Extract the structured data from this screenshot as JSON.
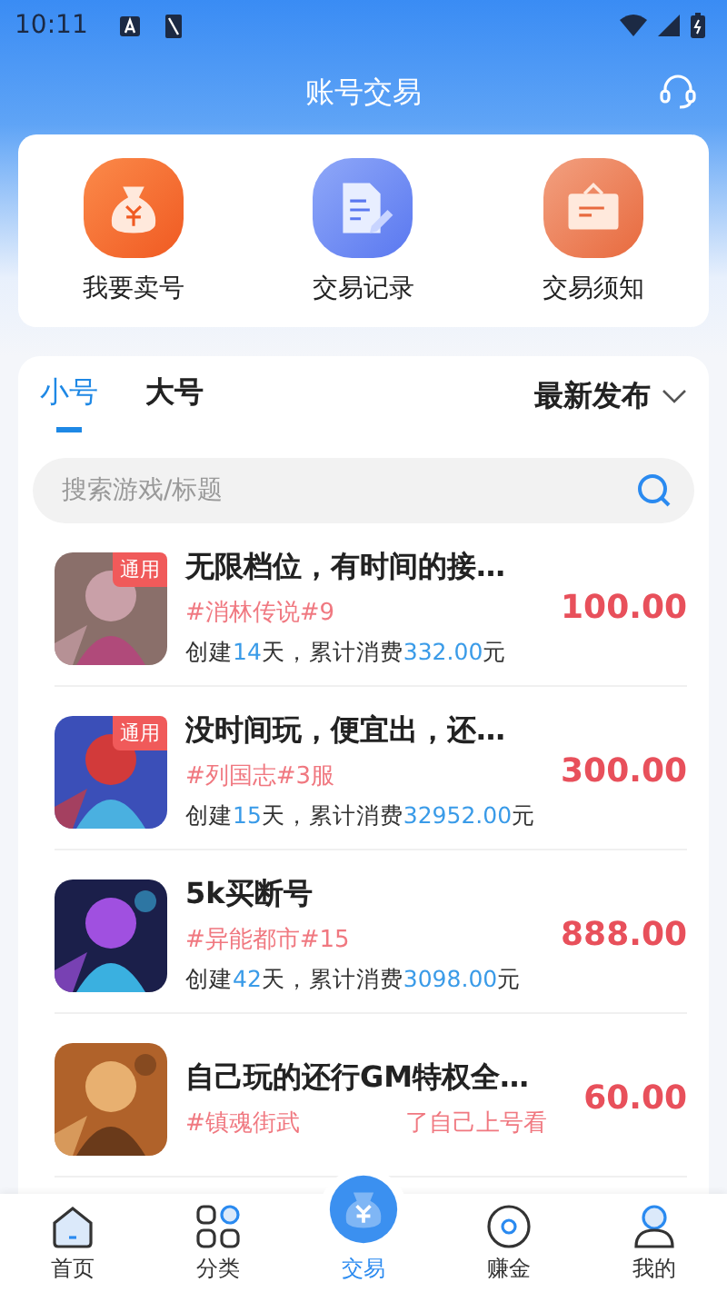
{
  "status_bar": {
    "time": "10:11"
  },
  "header": {
    "title": "账号交易"
  },
  "quick_actions": [
    {
      "label": "我要卖号",
      "kind": "sell"
    },
    {
      "label": "交易记录",
      "kind": "record"
    },
    {
      "label": "交易须知",
      "kind": "notice"
    }
  ],
  "tabs": [
    {
      "label": "小号",
      "selected": true
    },
    {
      "label": "大号",
      "selected": false
    }
  ],
  "sort": {
    "label": "最新发布"
  },
  "search": {
    "placeholder": "搜索游戏/标题"
  },
  "listings": [
    {
      "badge": "通用",
      "title": "无限档位，有时间的接…",
      "tag": "#消林传说#9",
      "meta": [
        {
          "text": "创建",
          "highlight": false
        },
        {
          "text": "14",
          "highlight": true
        },
        {
          "text": "天，累计消费",
          "highlight": false
        },
        {
          "text": "332.00",
          "highlight": true
        },
        {
          "text": "元",
          "highlight": false
        }
      ],
      "price": "100.00"
    },
    {
      "badge": "通用",
      "title": "没时间玩，便宜出，还…",
      "tag": "#列国志#3服",
      "meta": [
        {
          "text": "创建",
          "highlight": false
        },
        {
          "text": "15",
          "highlight": true
        },
        {
          "text": "天，累计消费",
          "highlight": false
        },
        {
          "text": "32952.00",
          "highlight": true
        },
        {
          "text": "元",
          "highlight": false
        }
      ],
      "price": "300.00"
    },
    {
      "title": "5k买断号",
      "tag": "#异能都市#15",
      "meta": [
        {
          "text": "创建",
          "highlight": false
        },
        {
          "text": "42",
          "highlight": true
        },
        {
          "text": "天，累计消费",
          "highlight": false
        },
        {
          "text": "3098.00",
          "highlight": true
        },
        {
          "text": "元",
          "highlight": false
        }
      ],
      "price": "888.00"
    },
    {
      "title": "自己玩的还行GM特权全…",
      "tag": "#镇魂街武",
      "tag_tail": "了自己上号看",
      "price": "60.00"
    }
  ],
  "nav": [
    {
      "label": "首页",
      "kind": "home",
      "selected": false
    },
    {
      "label": "分类",
      "kind": "grid",
      "selected": false
    },
    {
      "label": "交易",
      "kind": "trade",
      "selected": true
    },
    {
      "label": "赚金",
      "kind": "disc",
      "selected": false
    },
    {
      "label": "我的",
      "kind": "person",
      "selected": false
    }
  ]
}
